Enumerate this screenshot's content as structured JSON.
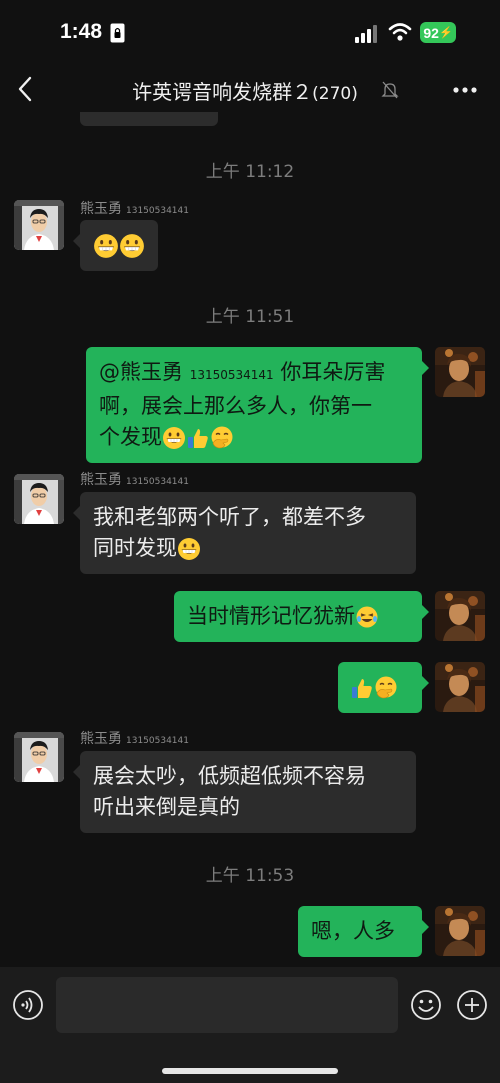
{
  "status_bar": {
    "time": "1:48",
    "battery": "92"
  },
  "nav": {
    "title": "许英谔音响发烧群２",
    "member_count": "(270)"
  },
  "timestamps": [
    "上午 11:12",
    "上午 11:51",
    "上午 11:53"
  ],
  "messages": [
    {
      "sender_name": "熊玉勇",
      "sender_phone": "13150534141",
      "text": ""
    },
    {
      "mention_name": "@熊玉勇",
      "mention_phone": "13150534141",
      "text_line1": " 你耳朵厉害",
      "text_line2": "啊，展会上那么多人，你第一",
      "text_line3": "个发现"
    },
    {
      "sender_name": "熊玉勇",
      "sender_phone": "13150534141",
      "text_line1": "我和老邹两个听了，都差不多",
      "text_line2": "同时发现"
    },
    {
      "text": "当时情形记忆犹新"
    },
    {
      "text": ""
    },
    {
      "sender_name": "熊玉勇",
      "sender_phone": "13150534141",
      "text_line1": "展会太吵，低频超低频不容易",
      "text_line2": "听出来倒是真的"
    },
    {
      "text": "嗯，人多"
    }
  ],
  "icons": {
    "grin_emoji": "grinning-face-icon",
    "thumbs_up_emoji": "thumbs-up-icon",
    "shy_emoji": "face-with-hand-over-mouth-icon",
    "laugh_emoji": "rolling-laughing-icon"
  },
  "colors": {
    "background": "#111111",
    "incoming_bubble": "#2c2c2c",
    "outgoing_bubble": "#23b35a",
    "timestamp": "#7d7d7d",
    "battery": "#34c759"
  }
}
